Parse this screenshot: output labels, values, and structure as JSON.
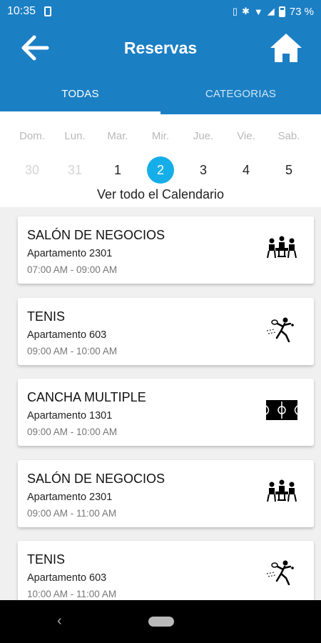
{
  "status_bar": {
    "time": "10:35",
    "battery": "73 %"
  },
  "header": {
    "title": "Reservas"
  },
  "tabs": [
    {
      "label": "TODAS",
      "active": true
    },
    {
      "label": "CATEGORIAS",
      "active": false
    }
  ],
  "calendar": {
    "day_names": [
      "Dom.",
      "Lun.",
      "Mar.",
      "Mir.",
      "Jue.",
      "Vie.",
      "Sab."
    ],
    "days": [
      {
        "num": "30",
        "muted": true
      },
      {
        "num": "31",
        "muted": true
      },
      {
        "num": "1",
        "muted": false
      },
      {
        "num": "2",
        "muted": false,
        "selected": true
      },
      {
        "num": "3",
        "muted": false
      },
      {
        "num": "4",
        "muted": false
      },
      {
        "num": "5",
        "muted": false
      }
    ],
    "view_all": "Ver todo el Calendario"
  },
  "reservations": [
    {
      "title": "SALÓN DE NEGOCIOS",
      "unit": "Apartamento 2301",
      "time": "07:00 AM - 09:00 AM",
      "icon": "meeting-icon"
    },
    {
      "title": "TENIS",
      "unit": "Apartamento 603",
      "time": "09:00 AM - 10:00 AM",
      "icon": "tennis-icon"
    },
    {
      "title": "CANCHA MULTIPLE",
      "unit": "Apartamento 1301",
      "time": "09:00 AM - 10:00 AM",
      "icon": "court-icon"
    },
    {
      "title": "SALÓN DE NEGOCIOS",
      "unit": "Apartamento 2301",
      "time": "09:00 AM - 11:00 AM",
      "icon": "meeting-icon"
    },
    {
      "title": "TENIS",
      "unit": "Apartamento 603",
      "time": "10:00 AM - 11:00 AM",
      "icon": "tennis-icon"
    }
  ],
  "colors": {
    "primary": "#1b7fc4",
    "selected_day": "#16aee8",
    "background": "#f0f0f0"
  }
}
